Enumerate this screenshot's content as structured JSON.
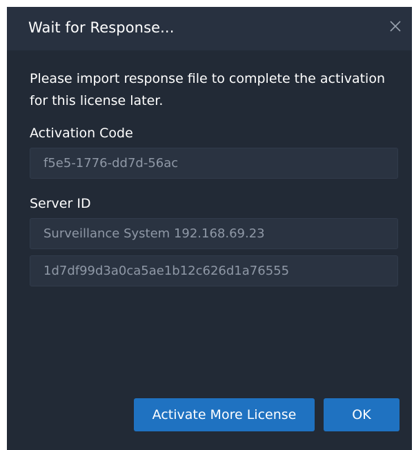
{
  "dialog": {
    "title": "Wait for Response...",
    "message": "Please import response file to complete the activation for this license later.",
    "activation_code": {
      "label": "Activation Code",
      "value": "f5e5-1776-dd7d-56ac"
    },
    "server_id": {
      "label": "Server ID",
      "name_value": "Surveillance System 192.168.69.23",
      "id_value": "1d7df99d3a0ca5ae1b12c626d1a76555"
    },
    "buttons": {
      "activate_more": "Activate More License",
      "ok": "OK"
    },
    "icons": {
      "close": "close-icon"
    },
    "colors": {
      "background": "#222a36",
      "titlebar": "#283140",
      "field_background": "#2a3341",
      "field_text": "#8f98a6",
      "primary_button": "#1f72c1"
    }
  }
}
